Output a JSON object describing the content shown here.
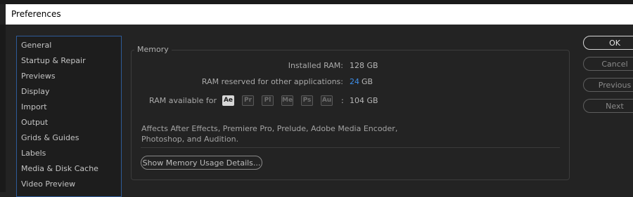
{
  "window": {
    "title": "Preferences"
  },
  "sidebar": {
    "items": [
      {
        "label": "General"
      },
      {
        "label": "Startup & Repair"
      },
      {
        "label": "Previews"
      },
      {
        "label": "Display"
      },
      {
        "label": "Import"
      },
      {
        "label": "Output"
      },
      {
        "label": "Grids & Guides"
      },
      {
        "label": "Labels"
      },
      {
        "label": "Media & Disk Cache"
      },
      {
        "label": "Video Preview"
      }
    ]
  },
  "memory": {
    "section_title": "Memory",
    "installed_ram_label": "Installed RAM:",
    "installed_ram_value": "128 GB",
    "reserved_label": "RAM reserved for other applications:",
    "reserved_value": "24",
    "reserved_unit": "GB",
    "available_label": "RAM available for",
    "apps": [
      "Ae",
      "Pr",
      "Pl",
      "Me",
      "Ps",
      "Au"
    ],
    "available_separator": ":",
    "available_value": "104 GB",
    "description": "Affects After Effects, Premiere Pro, Prelude, Adobe Media Encoder, Photoshop, and Audition.",
    "details_button": "Show Memory Usage Details..."
  },
  "actions": {
    "ok": "OK",
    "cancel": "Cancel",
    "previous": "Previous",
    "next": "Next"
  },
  "colors": {
    "accent": "#3e8ee8",
    "selection_border": "#2e5b99",
    "background": "#232323"
  }
}
